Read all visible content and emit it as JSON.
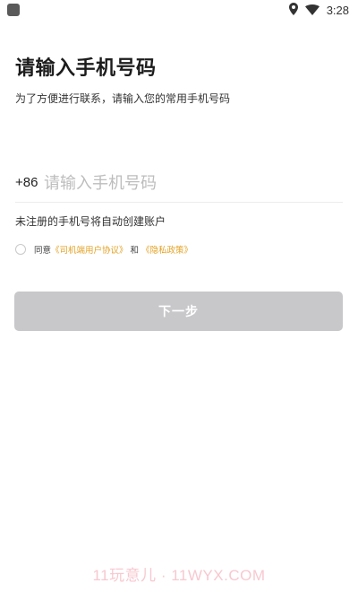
{
  "status_bar": {
    "time": "3:28",
    "icons": [
      "location-icon",
      "wifi-icon"
    ]
  },
  "login": {
    "title": "请输入手机号码",
    "subtitle": "为了方便进行联系，请输入您的常用手机号码",
    "country_code": "+86",
    "phone_placeholder": "请输入手机号码",
    "phone_value": "",
    "hint": "未注册的手机号将自动创建账户",
    "agreement": {
      "checked": false,
      "prefix": "同意",
      "user_agreement": "《司机端用户协议》",
      "connector": "和",
      "privacy_policy": "《隐私政策》"
    },
    "next_button": "下一步"
  },
  "watermark": "11玩意儿 · 11WYX.COM",
  "colors": {
    "link": "#e3a224",
    "button_disabled": "#c8c8cb",
    "placeholder": "#bdbdbd"
  }
}
